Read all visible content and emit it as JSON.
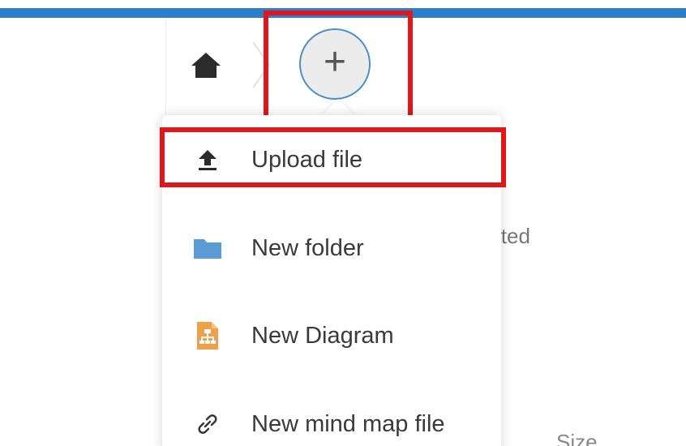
{
  "breadcrumb": {
    "home_icon": "home-icon",
    "separator_icon": "chevron-right-icon"
  },
  "new_button": {
    "label": "+",
    "icon": "plus-icon"
  },
  "new_menu": {
    "items": [
      {
        "label": "Upload file",
        "icon": "upload-icon"
      },
      {
        "label": "New folder",
        "icon": "folder-icon"
      },
      {
        "label": "New Diagram",
        "icon": "diagram-file-icon"
      },
      {
        "label": "New mind map file",
        "icon": "link-icon"
      }
    ]
  },
  "file_list": {
    "partial_header_modified": "ited",
    "partial_header_size": "Size"
  },
  "colors": {
    "header_accent": "#2e7dc8",
    "highlight": "#e0161b",
    "folder_blue": "#5b9bd5",
    "diagram_orange": "#f0a04b"
  }
}
